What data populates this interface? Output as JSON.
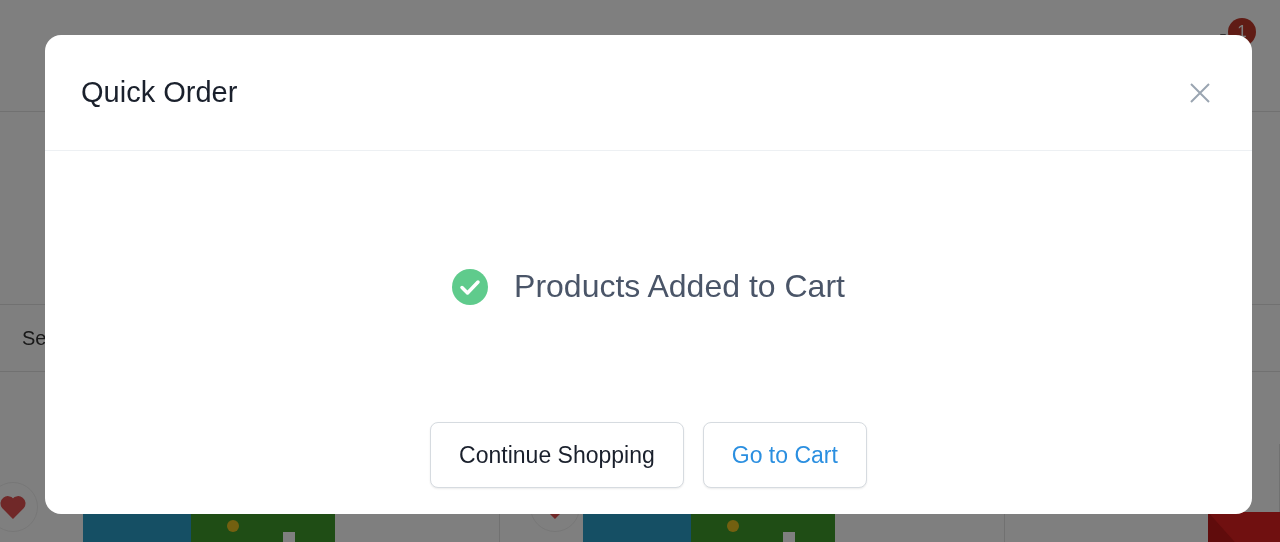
{
  "header": {
    "cart_badge": "1"
  },
  "search": {
    "placeholder": "Se"
  },
  "modal": {
    "title": "Quick Order",
    "message": "Products Added to Cart",
    "buttons": [
      {
        "label": "Continue Shopping",
        "kind": "secondary"
      },
      {
        "label": "Go to Cart",
        "kind": "primary"
      }
    ]
  }
}
